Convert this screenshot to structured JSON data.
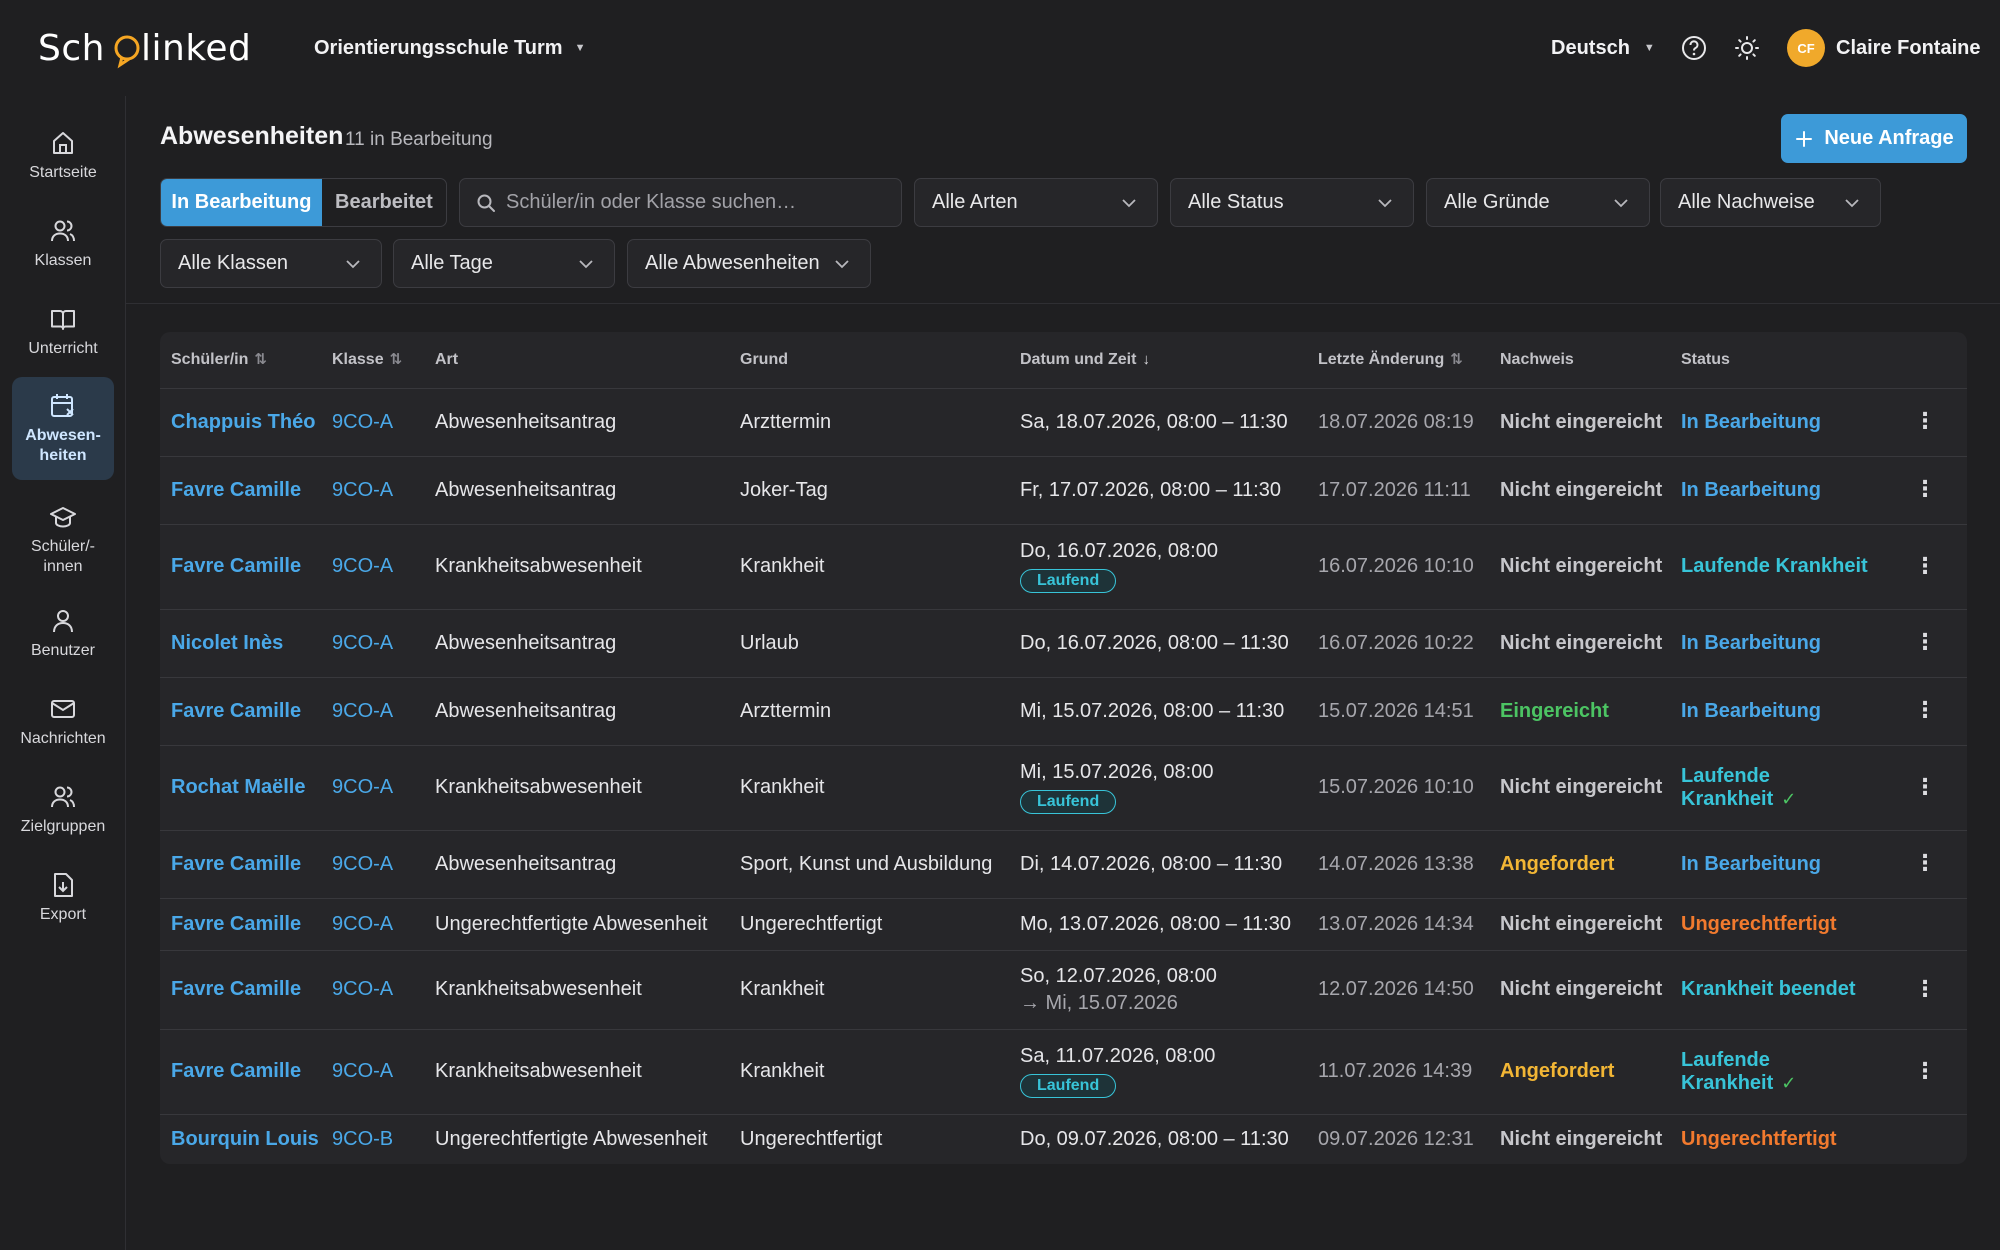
{
  "topbar": {
    "logo_text": "SchoolInked",
    "school": "Orientierungsschule Turm",
    "language": "Deutsch",
    "user_initials": "CF",
    "user_name": "Claire Fontaine"
  },
  "sidebar": {
    "items": [
      {
        "label": "Startseite",
        "icon": "home-icon"
      },
      {
        "label": "Klassen",
        "icon": "users-icon"
      },
      {
        "label": "Unterricht",
        "icon": "book-icon"
      },
      {
        "label": "Abwesen-\nheiten",
        "icon": "calendar-x-icon",
        "active": true
      },
      {
        "label": "Schüler/-\ninnen",
        "icon": "graduation-cap-icon"
      },
      {
        "label": "Benutzer",
        "icon": "user-icon"
      },
      {
        "label": "Nachrichten",
        "icon": "mail-icon"
      },
      {
        "label": "Zielgruppen",
        "icon": "users-group-icon"
      },
      {
        "label": "Export",
        "icon": "file-export-icon"
      }
    ]
  },
  "header": {
    "title": "Abwesenheiten",
    "subtitle": "11 in Bearbeitung",
    "new_button": "Neue Anfrage"
  },
  "filters": {
    "tab_active": "In Bearbeitung",
    "tab_other": "Bearbeitet",
    "search_placeholder": "Schüler/in oder Klasse suchen…",
    "types": "Alle Arten",
    "status": "Alle Status",
    "reasons": "Alle Gründe",
    "proofs": "Alle Nachweise",
    "classes": "Alle Klassen",
    "days": "Alle Tage",
    "absences": "Alle Abwesenheiten"
  },
  "table": {
    "headers": {
      "student": "Schüler/in",
      "class": "Klasse",
      "type": "Art",
      "reason": "Grund",
      "datetime": "Datum und Zeit",
      "last_change": "Letzte Änderung",
      "proof": "Nachweis",
      "status": "Status"
    },
    "rows": [
      {
        "student": "Chappuis Théo",
        "class": "9CO-A",
        "type": "Abwesenheitsantrag",
        "reason": "Arzttermin",
        "date": "Sa, 18.07.2026, 08:00 – 11:30",
        "change": "18.07.2026 08:19",
        "proof": "Nicht eingereicht",
        "status": "In Bearbeitung"
      },
      {
        "student": "Favre Camille",
        "class": "9CO-A",
        "type": "Abwesenheitsantrag",
        "reason": "Joker-Tag",
        "date": "Fr, 17.07.2026, 08:00 – 11:30",
        "change": "17.07.2026 11:11",
        "proof": "Nicht eingereicht",
        "status": "In Bearbeitung"
      },
      {
        "student": "Favre Camille",
        "class": "9CO-A",
        "type": "Krankheitsabwesenheit",
        "reason": "Krankheit",
        "date": "Do, 16.07.2026, 08:00",
        "badge": "Laufend",
        "change": "16.07.2026 10:10",
        "proof": "Nicht eingereicht",
        "status": "Laufende Krankheit"
      },
      {
        "student": "Nicolet Inès",
        "class": "9CO-A",
        "type": "Abwesenheitsantrag",
        "reason": "Urlaub",
        "date": "Do, 16.07.2026, 08:00 – 11:30",
        "change": "16.07.2026 10:22",
        "proof": "Nicht eingereicht",
        "status": "In Bearbeitung"
      },
      {
        "student": "Favre Camille",
        "class": "9CO-A",
        "type": "Abwesenheitsantrag",
        "reason": "Arzttermin",
        "date": "Mi, 15.07.2026, 08:00 – 11:30",
        "change": "15.07.2026 14:51",
        "proof": "Eingereicht",
        "status": "In Bearbeitung"
      },
      {
        "student": "Rochat Maëlle",
        "class": "9CO-A",
        "type": "Krankheitsabwesenheit",
        "reason": "Krankheit",
        "date": "Mi, 15.07.2026, 08:00",
        "badge": "Laufend",
        "change": "15.07.2026 10:10",
        "proof": "Nicht eingereicht",
        "status": "Laufende Krankheit"
      },
      {
        "student": "Favre Camille",
        "class": "9CO-A",
        "type": "Abwesenheitsantrag",
        "reason": "Sport, Kunst und Ausbildung",
        "date": "Di, 14.07.2026, 08:00 – 11:30",
        "change": "14.07.2026 13:38",
        "proof": "Angefordert",
        "status": "In Bearbeitung"
      },
      {
        "student": "Favre Camille",
        "class": "9CO-A",
        "type": "Ungerechtfertigte Abwesenheit",
        "reason": "Ungerechtfertigt",
        "date": "Mo, 13.07.2026, 08:00 – 11:30",
        "change": "13.07.2026 14:34",
        "proof": "Nicht eingereicht",
        "status": "Ungerechtfertigt"
      },
      {
        "student": "Favre Camille",
        "class": "9CO-A",
        "type": "Krankheitsabwesenheit",
        "reason": "Krankheit",
        "date": "So, 12.07.2026, 08:00",
        "date_end": "→ Mi, 15.07.2026",
        "change": "12.07.2026 14:50",
        "proof": "Nicht eingereicht",
        "status": "Krankheit beendet"
      },
      {
        "student": "Favre Camille",
        "class": "9CO-A",
        "type": "Krankheitsabwesenheit",
        "reason": "Krankheit",
        "date": "Sa, 11.07.2026, 08:00",
        "badge": "Laufend",
        "change": "11.07.2026 14:39",
        "proof": "Angefordert",
        "status": "Laufende Krankheit"
      },
      {
        "student": "Bourquin Louis",
        "class": "9CO-B",
        "type": "Ungerechtfertigte Abwesenheit",
        "reason": "Ungerechtfertigt",
        "date": "Do, 09.07.2026, 08:00 – 11:30",
        "change": "09.07.2026 12:31",
        "proof": "Nicht eingereicht",
        "status": "Ungerechtfertigt"
      }
    ]
  },
  "colors": {
    "accent": "#3d9ad8",
    "link": "#4aa8e8",
    "ongoing": "#38c4d8",
    "unjustified": "#f27a2e",
    "submitted": "#4cc463",
    "requested": "#f2b635"
  }
}
